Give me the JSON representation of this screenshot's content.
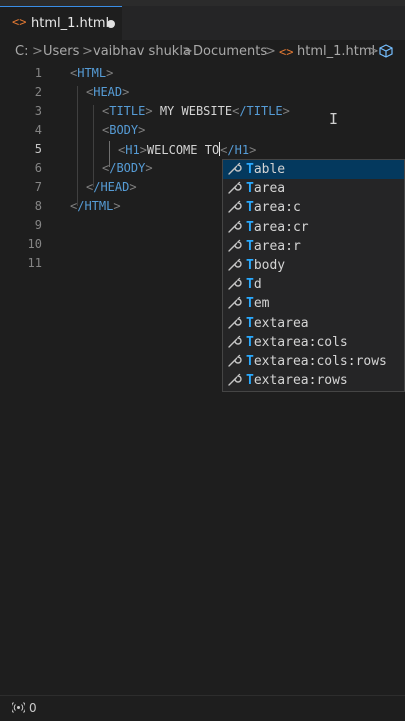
{
  "tab": {
    "title": "html_1.html",
    "icon": "<>"
  },
  "breadcrumb": {
    "drive": "C:",
    "sep": ">",
    "folder1": "Users",
    "folder2": "vaibhav shukla",
    "folder3": "Documents",
    "file": "html_1.html",
    "file_icon": "<>",
    "symbol_icon": "cube-icon"
  },
  "editor": {
    "active_line": 5,
    "line_numbers": [
      "1",
      "2",
      "3",
      "4",
      "5",
      "6",
      "7",
      "8",
      "9",
      "10",
      "11"
    ],
    "lines": {
      "l1": "HTML",
      "l2": "HEAD",
      "l3_tag": "TITLE",
      "l3_text": " MY WEBSITE",
      "l3_close": "/TITLE",
      "l4": "BODY",
      "l5_tag": "H1",
      "l5_text": "WELCOME TO",
      "l5_close": "/H1",
      "l6": "/BODY",
      "l7": "/HEAD",
      "l8": "/HTML"
    }
  },
  "suggestions": {
    "selected_index": 0,
    "match_prefix": "T",
    "items": [
      "Table",
      "Tarea",
      "Tarea:c",
      "Tarea:cr",
      "Tarea:r",
      "Tbody",
      "Td",
      "Tem",
      "Textarea",
      "Textarea:cols",
      "Textarea:cols:rows",
      "Textarea:rows"
    ]
  },
  "status": {
    "port_count": "0",
    "icon": "broadcast-icon"
  },
  "colors": {
    "background": "#1e1e1e",
    "tag": "#569cd6",
    "bracket": "#808080",
    "match_highlight": "#2aaaff",
    "selected_item": "#04395e",
    "tab_accent": "#3a8ee6"
  }
}
